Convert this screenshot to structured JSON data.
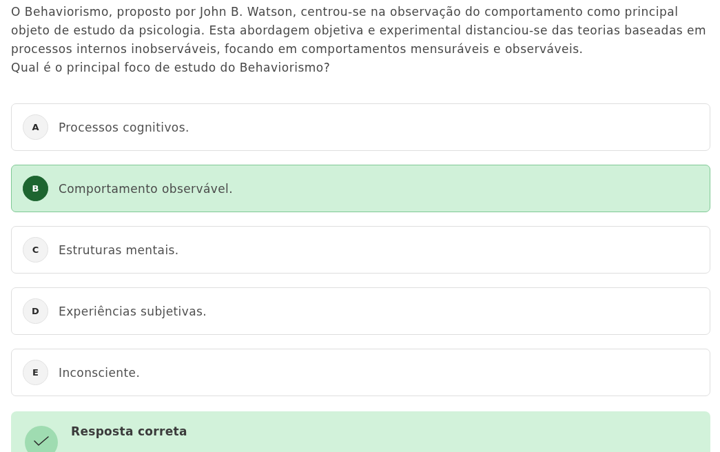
{
  "question": {
    "text": "O Behaviorismo, proposto por John B. Watson, centrou-se na observação do comportamento como principal objeto de estudo da psicologia. Esta abordagem objetiva e experimental distanciou-se das teorias baseadas em processos internos inobserváveis, focando em comportamentos mensuráveis e observáveis.",
    "prompt": "Qual é o principal foco de estudo do Behaviorismo?"
  },
  "options": [
    {
      "letter": "A",
      "text": "Processos cognitivos.",
      "selected": false
    },
    {
      "letter": "B",
      "text": "Comportamento observável.",
      "selected": true
    },
    {
      "letter": "C",
      "text": "Estruturas mentais.",
      "selected": false
    },
    {
      "letter": "D",
      "text": "Experiências subjetivas.",
      "selected": false
    },
    {
      "letter": "E",
      "text": "Inconsciente.",
      "selected": false
    }
  ],
  "feedback": {
    "correct": true,
    "title": "Resposta correta"
  }
}
